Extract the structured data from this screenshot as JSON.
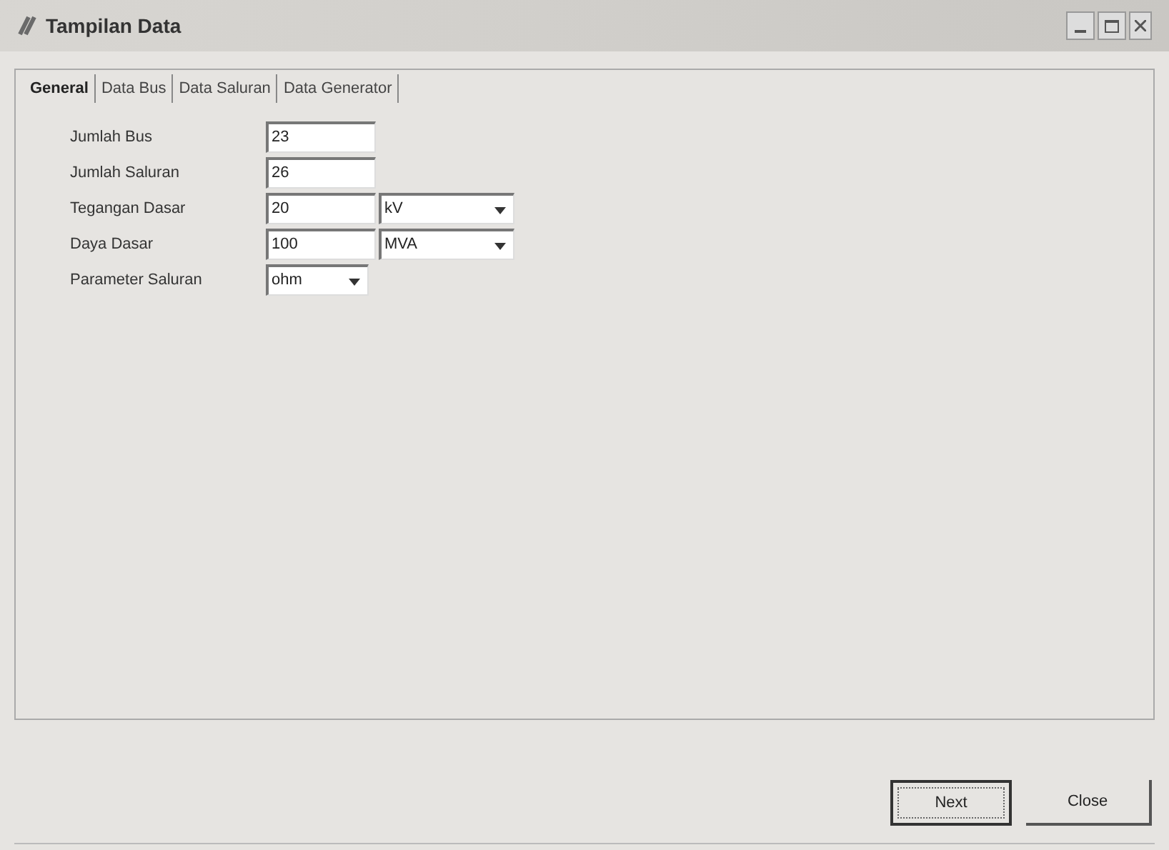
{
  "window": {
    "title": "Tampilan Data"
  },
  "tabs": [
    {
      "label": "General",
      "selected": true
    },
    {
      "label": "Data Bus",
      "selected": false
    },
    {
      "label": "Data Saluran",
      "selected": false
    },
    {
      "label": "Data Generator",
      "selected": false
    }
  ],
  "fields": [
    {
      "label": "Jumlah Bus",
      "value": "23"
    },
    {
      "label": "Jumlah Saluran",
      "value": "26"
    },
    {
      "label": "Tegangan Dasar",
      "value": "20",
      "unit": "kV"
    },
    {
      "label": "Daya Dasar",
      "value": "100",
      "unit": "MVA"
    },
    {
      "label": "Parameter Saluran",
      "select": "ohm"
    }
  ],
  "buttons": [
    {
      "label": "Next",
      "default": true
    },
    {
      "label": "Close",
      "default": false
    }
  ]
}
